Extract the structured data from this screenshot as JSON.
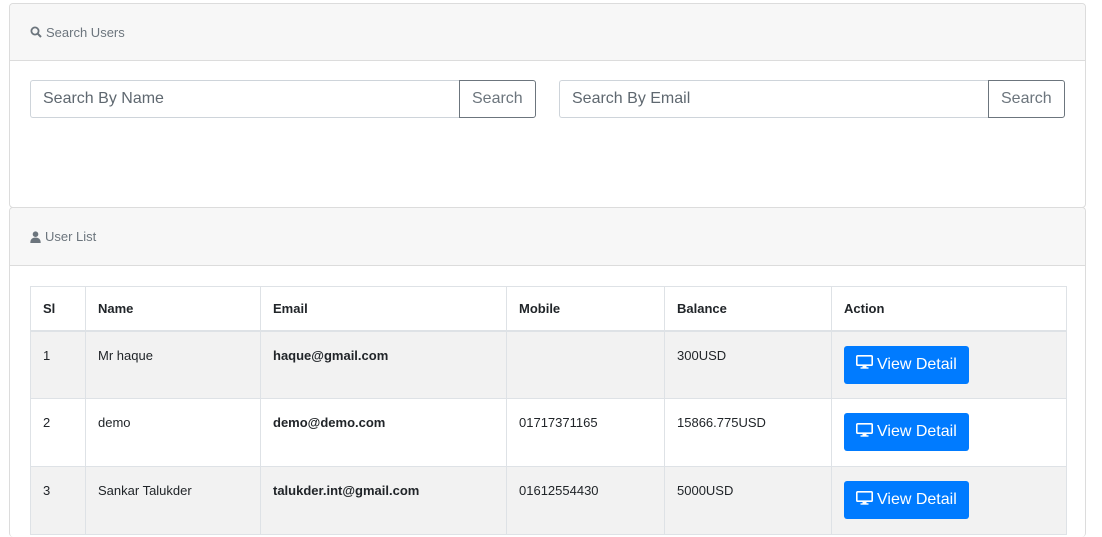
{
  "search_card": {
    "title": "Search Users",
    "name_search": {
      "placeholder": "Search By Name",
      "button_label": "Search"
    },
    "email_search": {
      "placeholder": "Search By Email",
      "button_label": "Search"
    }
  },
  "user_list": {
    "title": "User List",
    "columns": [
      "Sl",
      "Name",
      "Email",
      "Mobile",
      "Balance",
      "Action"
    ],
    "rows": [
      {
        "sl": "1",
        "name": "Mr haque",
        "email": "haque@gmail.com",
        "mobile": "",
        "balance": "300USD",
        "action": "View Detail"
      },
      {
        "sl": "2",
        "name": "demo",
        "email": "demo@demo.com",
        "mobile": "01717371165",
        "balance": "15866.775USD",
        "action": "View Detail"
      },
      {
        "sl": "3",
        "name": "Sankar Talukder",
        "email": "talukder.int@gmail.com",
        "mobile": "01612554430",
        "balance": "5000USD",
        "action": "View Detail"
      }
    ]
  },
  "icons": {
    "search_header": "search-icon",
    "user_header": "user-icon",
    "view_button": "monitor-icon"
  },
  "colors": {
    "primary": "#007bff",
    "header_bg": "#f7f7f7",
    "stripe": "#f2f2f2",
    "muted": "#6c757d"
  }
}
